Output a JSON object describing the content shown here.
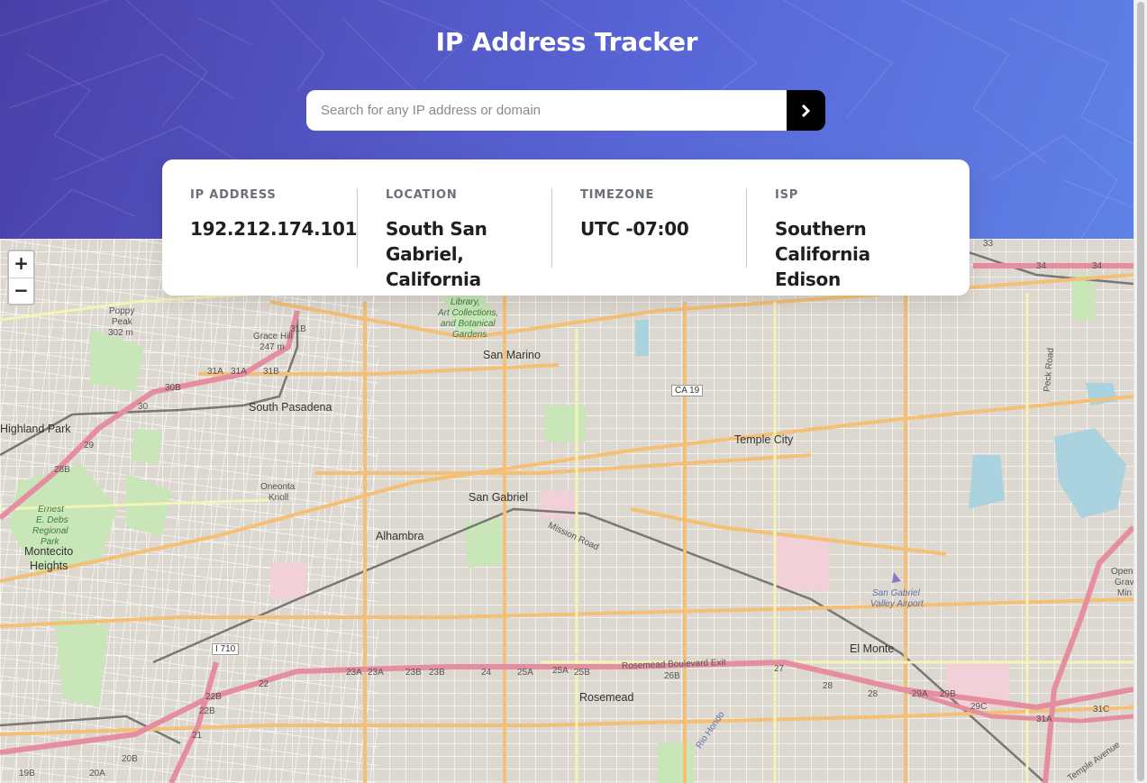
{
  "header": {
    "title": "IP Address Tracker"
  },
  "search": {
    "placeholder": "Search for any IP address or domain",
    "value": "",
    "submit_icon": "chevron-right-icon"
  },
  "info": {
    "ip_label": "IP ADDRESS",
    "ip_value": "192.212.174.101",
    "location_label": "LOCATION",
    "location_value": "South San Gabriel, California",
    "timezone_label": "TIMEZONE",
    "timezone_value": "UTC -07:00",
    "isp_label": "ISP",
    "isp_value": "Southern California Edison"
  },
  "map": {
    "zoom_in": "+",
    "zoom_out": "−",
    "places": {
      "san_marino": "San Marino",
      "south_pasadena": "South Pasadena",
      "highland_park": "Highland Park",
      "temple_city": "Temple City",
      "san_gabriel": "San Gabriel",
      "alhambra": "Alhambra",
      "montecito_heights_1": "Montecito",
      "montecito_heights_2": "Heights",
      "el_monte": "El Monte",
      "rosemead": "Rosemead"
    },
    "small_labels": {
      "poppy_peak_1": "Poppy",
      "poppy_peak_2": "Peak",
      "poppy_peak_3": "302 m",
      "grace_hill_1": "Grace Hill",
      "grace_hill_2": "247 m",
      "oneonta_1": "Oneonta",
      "oneonta_2": "Knoll",
      "mission_road": "Mission Road",
      "rosemead_blvd_exit": "Rosemead Boulevard Exit",
      "peck_road": "Peck Road",
      "temple_avenue": "Temple Avenue",
      "rio_hondo": "Rio Hondo",
      "open_grave_1": "Open",
      "open_grave_2": "Grav",
      "open_grave_3": "Min"
    },
    "park_labels": {
      "library_1": "Library,",
      "library_2": "Art Collections,",
      "library_3": "and Botanical",
      "library_4": "Gardens",
      "ernest_1": "Ernest",
      "ernest_2": "E. Debs",
      "ernest_3": "Regional",
      "ernest_4": "Park"
    },
    "airport_1": "San Gabriel",
    "airport_2": "Valley Airport",
    "shields": {
      "ca19": "CA 19",
      "i710": "I 710"
    },
    "exits": [
      "31B",
      "31A",
      "31A",
      "31B",
      "30B",
      "30",
      "29",
      "28B",
      "23A",
      "23A",
      "23B",
      "23B",
      "24",
      "25A",
      "25A",
      "25B",
      "26B",
      "27",
      "28",
      "28",
      "29A",
      "29B",
      "29C",
      "31A",
      "31C",
      "22B",
      "22B",
      "22",
      "21",
      "20B",
      "20A",
      "19B",
      "33",
      "34",
      "34"
    ]
  },
  "colors": {
    "header_start": "#4a3fa8",
    "header_end": "#5f82e6",
    "submit_bg": "#000000",
    "motorway": "#e892a2",
    "primary_road": "#f9c779",
    "secondary_road": "#f7fabf"
  }
}
